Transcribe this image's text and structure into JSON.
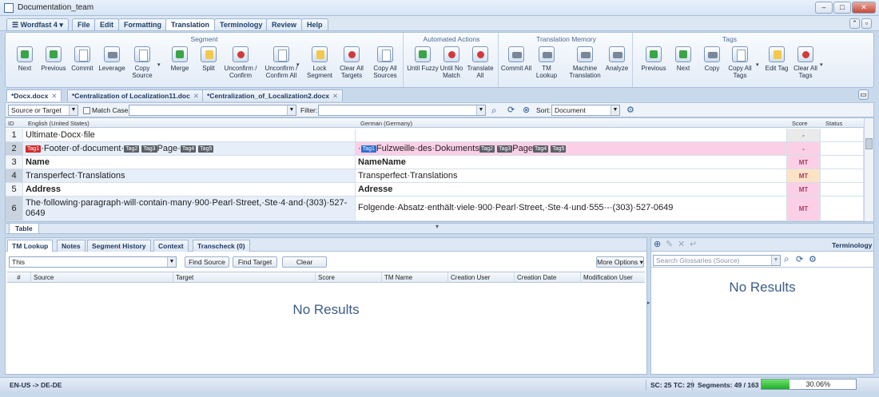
{
  "window": {
    "title": "Documentation_team"
  },
  "menu": {
    "app_menu": "Wordfast 4",
    "tabs": [
      "File",
      "Edit",
      "Formatting",
      "Translation",
      "Terminology",
      "Review",
      "Help"
    ],
    "active": "Translation"
  },
  "ribbon": {
    "groups": [
      {
        "title": "Segment",
        "buttons": [
          "Next",
          "Previous",
          "Commit",
          "Leverage",
          "Copy Source",
          "Merge",
          "Split",
          "Unconfirm / Confirm",
          "Unconfirm / Confirm All",
          "Lock Segment",
          "Clear All Targets",
          "Copy All Sources"
        ]
      },
      {
        "title": "Automated Actions",
        "buttons": [
          "Until Fuzzy",
          "Until No Match",
          "Translate All"
        ]
      },
      {
        "title": "Translation Memory",
        "buttons": [
          "Commit All",
          "TM Lookup",
          "Machine Translation",
          "Analyze"
        ]
      },
      {
        "title": "Tags",
        "buttons": [
          "Previous",
          "Next",
          "Copy",
          "Copy All Tags",
          "Edit Tag",
          "Clear All Tags"
        ]
      }
    ]
  },
  "doc_tabs": [
    "*Docx.docx",
    "*Centralization of Localization11.doc",
    "*Centralization_of_Localization2.docx"
  ],
  "filter": {
    "scope": "Source or Target",
    "match_case": "Match Case",
    "filter_label": "Filter:",
    "sort_label": "Sort:",
    "sort_value": "Document"
  },
  "grid": {
    "headers": {
      "id": "ID",
      "source": "English (United States)",
      "target": "German (Germany)",
      "score": "Score",
      "status": "Status"
    },
    "rows": [
      {
        "id": "1",
        "source": "Ultimate·Docx·file",
        "target": "",
        "score": "-"
      },
      {
        "id": "2",
        "source_parts": {
          "t1": "Tag1",
          "a": "·Footer·of·document·",
          "t2": "Tag2",
          "t3": "Tag3",
          "b": "Page·",
          "t4": "Tag4",
          "t5": "Tag5"
        },
        "target_parts": {
          "a0": "·",
          "t1": "Tag1",
          "a": "Fulzweille·des·Dokuments",
          "t2": "Tag2",
          "t3": "Tag3",
          "b": "Page",
          "t4": "Tag4",
          "t5": "Tag5"
        },
        "score": "-"
      },
      {
        "id": "3",
        "source": "Name",
        "target": "NameName",
        "score": "MT"
      },
      {
        "id": "4",
        "source": "Transperfect·Translations",
        "target": "Transperfect·Translations",
        "score": "MT"
      },
      {
        "id": "5",
        "source": "Address",
        "target": "Adresse",
        "score": "MT"
      },
      {
        "id": "6",
        "source": "The·following·paragraph·will·contain·many·900·Pearl·Street,·Ste·4·and·(303)·527-0649",
        "target": "Folgende·Absatz·enthält·viele·900·Pearl·Street,·Ste·4·und·555·-·(303)·527-0649",
        "score": "MT"
      }
    ]
  },
  "table_tab": "Table",
  "lower": {
    "tabs": [
      "TM Lookup",
      "Notes",
      "Segment History",
      "Context",
      "Transcheck (0)"
    ],
    "search_value": "This",
    "find_source": "Find Source",
    "find_target": "Find Target",
    "clear": "Clear",
    "more_options": "More Options",
    "columns": [
      "#",
      "Source",
      "Target",
      "Score",
      "TM Name",
      "Creation User",
      "Creation Date",
      "Modification User"
    ],
    "no_results": "No Results"
  },
  "terminology": {
    "title": "Terminology",
    "search_placeholder": "Search Glossaries (Source)",
    "no_results": "No Results"
  },
  "status": {
    "lang_pair": "EN-US -> DE-DE",
    "sc_tc": "SC: 25 TC: 29",
    "segments": "Segments: 49 / 163",
    "progress_pct": 30.06,
    "progress_text": "30.06%"
  },
  "colors": {
    "accent": "#1fae2a",
    "target_highlight": "#fbd0e6",
    "tag_red": "#d12b2b",
    "tag_blue": "#2f6fd0"
  }
}
